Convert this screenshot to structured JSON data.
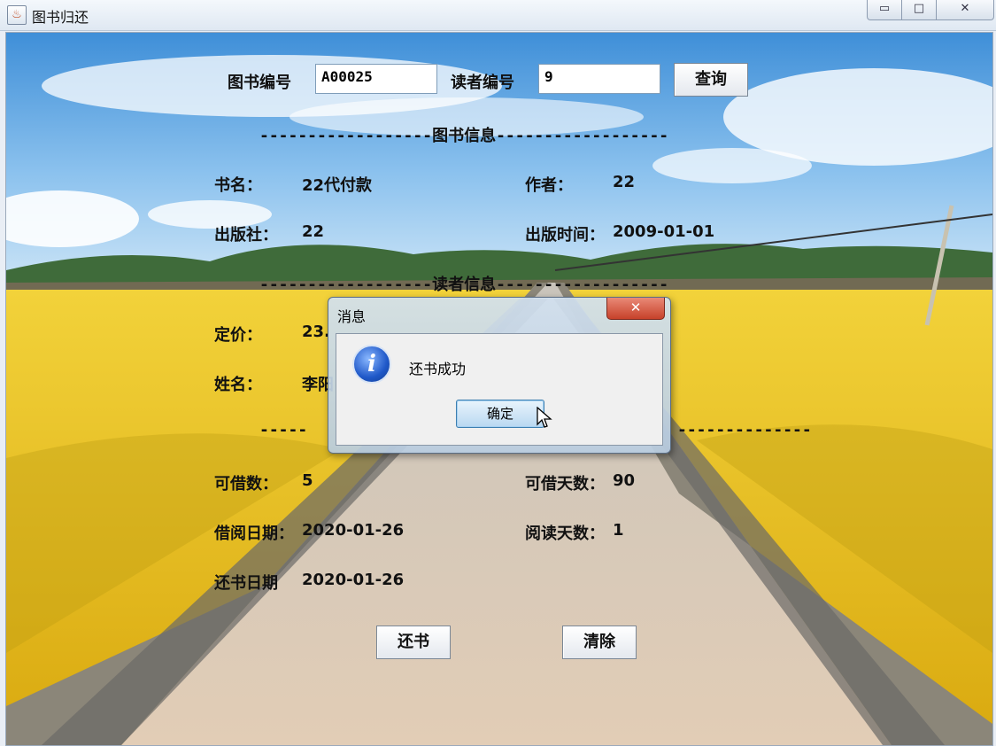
{
  "window": {
    "title": "图书归还",
    "min_glyph": "▭",
    "max_glyph": "□",
    "close_glyph": "✕",
    "app_icon": "java-cup-icon"
  },
  "query": {
    "book_id_label": "图书编号",
    "book_id_value": "A00025",
    "reader_id_label": "读者编号",
    "reader_id_value": "9",
    "search_button": "查询"
  },
  "book_section": {
    "divider": "------------------图书信息------------------",
    "title_label": "书名：",
    "title_value": "22代付款",
    "author_label": "作者：",
    "author_value": "22",
    "publisher_label": "出版社：",
    "publisher_value": "22",
    "pub_date_label": "出版时间：",
    "pub_date_value": "2009-01-01",
    "price_label": "定价：",
    "price_value": "23."
  },
  "reader_section": {
    "divider": "------------------读者信息------------------",
    "name_label": "姓名：",
    "name_value": "李阳"
  },
  "borrow_section": {
    "divider": "-----",
    "divider_right": "--------------",
    "borrowable_label": "可借数：",
    "borrowable_value": "5",
    "borrow_days_label": "可借天数：",
    "borrow_days_value": "90",
    "borrow_date_label": "借阅日期：",
    "borrow_date_value": "2020-01-26",
    "read_days_label": "阅读天数：",
    "read_days_value": "1",
    "return_date_label": "还书日期",
    "return_date_value": "2020-01-26"
  },
  "actions": {
    "return_button": "还书",
    "clear_button": "清除"
  },
  "dialog": {
    "title": "消息",
    "close_glyph": "✕",
    "message": "还书成功",
    "ok_button": "确定",
    "icon": "info-icon",
    "icon_glyph": "i"
  }
}
